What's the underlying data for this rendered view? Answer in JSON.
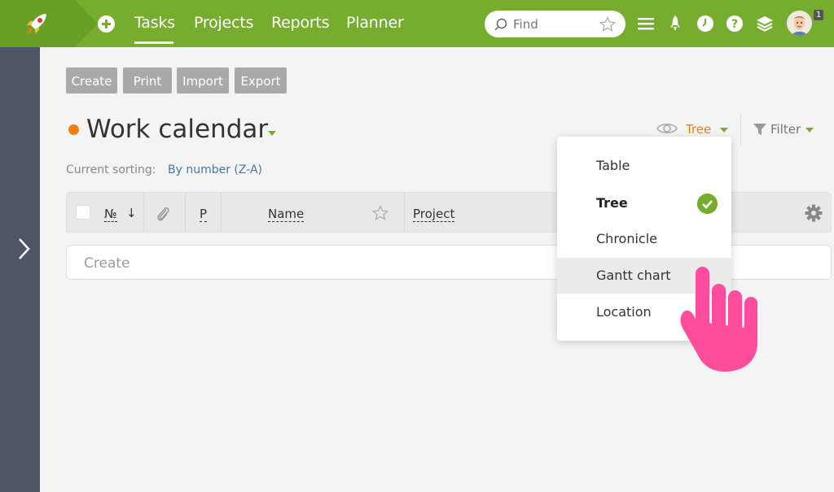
{
  "topbar": {
    "nav": [
      "Tasks",
      "Projects",
      "Reports",
      "Planner"
    ],
    "active_nav": "Tasks",
    "search_placeholder": "Find",
    "notification_count": "1",
    "colors": {
      "bar": "#76ad2f",
      "logo_bg": "#6a9f27"
    }
  },
  "toolbar": {
    "create": "Create",
    "print": "Print",
    "import": "Import",
    "export": "Export"
  },
  "page": {
    "title": "Work calendar",
    "view_label": "Tree",
    "filter_label": "Filter",
    "sorting_label": "Current sorting:",
    "sorting_value": "By number (Z-A)"
  },
  "table": {
    "columns": {
      "number": "№",
      "sort_arrow": "↓",
      "priority": "P",
      "name": "Name",
      "project": "Project"
    },
    "create_placeholder": "Create"
  },
  "view_menu": {
    "items": [
      "Table",
      "Tree",
      "Chronicle",
      "Gantt chart",
      "Location"
    ],
    "selected": "Tree",
    "hovered": "Gantt chart"
  },
  "colors": {
    "accent": "#76ad2f",
    "orange": "#f07f13",
    "link": "#4a74a8",
    "sidebar": "#505467"
  }
}
